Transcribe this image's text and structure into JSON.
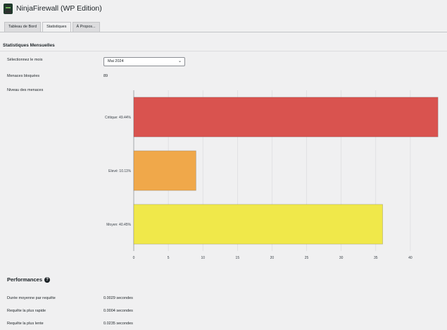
{
  "app": {
    "title": "NinjaFirewall (WP Edition)"
  },
  "tabs": [
    {
      "label": "Tableau de Bord",
      "active": false
    },
    {
      "label": "Statistiques",
      "active": true
    },
    {
      "label": "À Propos...",
      "active": false
    }
  ],
  "section": {
    "title": "Statistiques Mensuelles"
  },
  "month_select": {
    "label": "Sélectionnez le mois",
    "value": "Mai 2024"
  },
  "blocked": {
    "label": "Menaces bloquées",
    "value": "89"
  },
  "threat_level": {
    "label": "Niveau des menaces"
  },
  "chart_data": {
    "type": "bar",
    "orientation": "horizontal",
    "categories": [
      "Critique: 49.44%",
      "Elevé: 10.11%",
      "Moyen: 40.45%"
    ],
    "values": [
      44,
      9,
      36
    ],
    "colors": [
      "#d9534f",
      "#f0a84a",
      "#f0e84a"
    ],
    "xlim": [
      0,
      45
    ],
    "xticks": [
      "0",
      "5",
      "10",
      "15",
      "20",
      "25",
      "30",
      "35",
      "40"
    ],
    "grid": true
  },
  "performance": {
    "title": "Performances",
    "rows": [
      {
        "label": "Durée moyenne par requête",
        "value": "0.0029 secondes"
      },
      {
        "label": "Requête la plus rapide",
        "value": "0.0004 secondes"
      },
      {
        "label": "Requête la plus lente",
        "value": "0.0235 secondes"
      }
    ]
  }
}
